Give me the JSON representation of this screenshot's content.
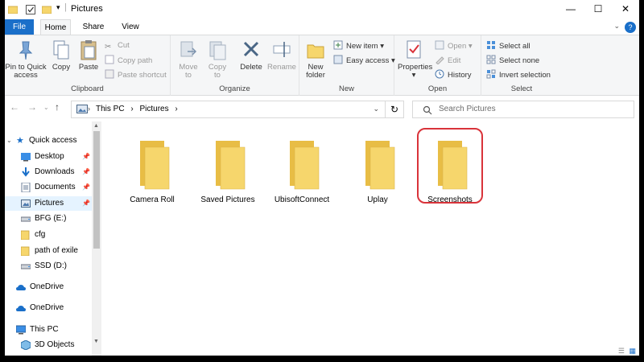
{
  "window": {
    "title": "Pictures",
    "controls": {
      "minimize": "—",
      "maximize": "☐",
      "close": "✕"
    }
  },
  "ribbon_tabs": [
    {
      "label": "File"
    },
    {
      "label": "Home"
    },
    {
      "label": "Share"
    },
    {
      "label": "View"
    }
  ],
  "ribbon": {
    "clipboard": {
      "pin_to_quick_access": "Pin to Quick access",
      "copy": "Copy",
      "paste": "Paste",
      "cut": "Cut",
      "copy_path": "Copy path",
      "paste_shortcut": "Paste shortcut",
      "label": "Clipboard"
    },
    "organize": {
      "move_to": "Move to",
      "copy_to": "Copy to",
      "delete": "Delete",
      "rename": "Rename",
      "label": "Organize"
    },
    "new": {
      "new_folder": "New folder",
      "new_item": "New item",
      "easy_access": "Easy access",
      "label": "New"
    },
    "open": {
      "properties": "Properties",
      "open": "Open",
      "edit": "Edit",
      "history": "History",
      "label": "Open"
    },
    "select": {
      "select_all": "Select all",
      "select_none": "Select none",
      "invert_selection": "Invert selection",
      "label": "Select"
    }
  },
  "address": {
    "path": [
      "This PC",
      "Pictures"
    ],
    "separator": "›",
    "search_placeholder": "Search Pictures"
  },
  "nav_pane": {
    "items": [
      {
        "label": "Quick access",
        "icon": "star-icon"
      },
      {
        "label": "Desktop",
        "icon": "desktop-icon",
        "pinned": true
      },
      {
        "label": "Downloads",
        "icon": "download-icon",
        "pinned": true
      },
      {
        "label": "Documents",
        "icon": "documents-icon",
        "pinned": true
      },
      {
        "label": "Pictures",
        "icon": "pictures-icon",
        "pinned": true,
        "selected": true
      },
      {
        "label": "BFG (E:)",
        "icon": "drive-icon"
      },
      {
        "label": "cfg",
        "icon": "folder-icon"
      },
      {
        "label": "path of exile",
        "icon": "folder-icon"
      },
      {
        "label": "SSD (D:)",
        "icon": "drive-icon"
      },
      {
        "label": "OneDrive",
        "icon": "cloud-icon"
      },
      {
        "label": "OneDrive",
        "icon": "cloud-icon"
      },
      {
        "label": "This PC",
        "icon": "computer-icon"
      },
      {
        "label": "3D Objects",
        "icon": "cube-icon"
      }
    ]
  },
  "folders": [
    {
      "label": "Camera Roll"
    },
    {
      "label": "Saved Pictures"
    },
    {
      "label": "UbisoftConnect"
    },
    {
      "label": "Uplay"
    },
    {
      "label": "Screenshots",
      "highlighted": true
    }
  ],
  "colors": {
    "accent": "#1a6fc9",
    "folder": "#f6d66c",
    "folder_dark": "#e8bd45",
    "highlight": "#d9333a",
    "selection": "#e5f3ff"
  }
}
